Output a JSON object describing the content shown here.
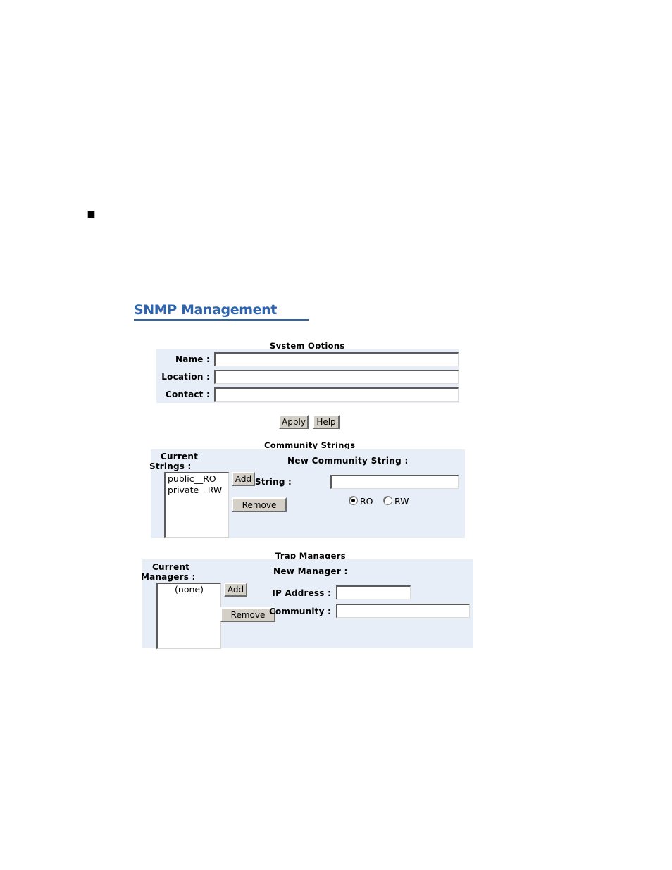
{
  "page": {
    "bullet_marker": "■",
    "title": "SNMP Management"
  },
  "system_options": {
    "heading": "System Options",
    "fields": [
      {
        "label": "Name :",
        "value": "",
        "placeholder": ""
      },
      {
        "label": "Location :",
        "value": "",
        "placeholder": ""
      },
      {
        "label": "Contact :",
        "value": "",
        "placeholder": ""
      }
    ],
    "buttons": [
      {
        "label": "Apply"
      },
      {
        "label": "Help"
      }
    ]
  },
  "community_strings": {
    "heading": "Community Strings",
    "current_label_line1": "Current",
    "current_label_line2": "Strings :",
    "current_items": [
      "public__RO",
      "private__RW"
    ],
    "add_label": "Add",
    "remove_label": "Remove",
    "new_heading": "New Community String :",
    "string_label": "String :",
    "string_value": "",
    "access_options": [
      {
        "label": "RO",
        "selected": true
      },
      {
        "label": "RW",
        "selected": false
      }
    ]
  },
  "trap_managers": {
    "heading": "Trap Managers",
    "current_label_line1": "Current",
    "current_label_line2": "Managers :",
    "current_items": [
      "(none)"
    ],
    "add_label": "Add",
    "remove_label": "Remove",
    "new_heading": "New Manager :",
    "ip_label": "IP Address :",
    "ip_value": "",
    "community_label": "Community :",
    "community_value": ""
  },
  "colors": {
    "title_blue": "#2e63ad",
    "panel_bg": "#e8eef7",
    "button_face": "#d4d0c8"
  }
}
